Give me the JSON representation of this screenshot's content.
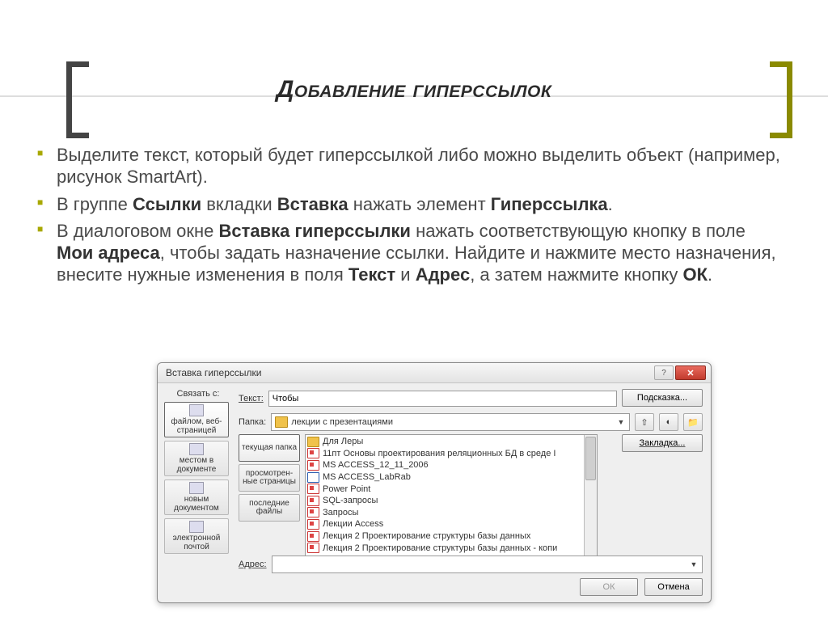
{
  "slide": {
    "title": "Добавление гиперссылок",
    "bullets": [
      {
        "pre": "Выделите текст, который будет гиперссылкой либо можно выделить объект (например, рисунок SmartArt)."
      },
      {
        "pre": "В группе ",
        "b1": "Ссылки",
        "mid1": " вкладки ",
        "b2": "Вставка",
        "mid2": " нажать элемент ",
        "b3": "Гиперссылка",
        "post": "."
      },
      {
        "pre": "В диалоговом окне ",
        "b1": "Вставка гиперссылки",
        "mid1": " нажать соответствующую кнопку в поле ",
        "b2": "Мои адреса",
        "mid2": ", чтобы задать назначение ссылки. Найдите и нажмите место назначения, внесите нужные изменения в поля ",
        "b3": "Текст",
        "mid3": " и ",
        "b4": "Адрес",
        "mid4": ", а затем нажмите кнопку ",
        "b5": "ОК",
        "post": "."
      }
    ]
  },
  "dialog": {
    "title": "Вставка гиперссылки",
    "link_with_label": "Связать с:",
    "tiles": [
      {
        "label": "файлом, веб-страницей",
        "active": true
      },
      {
        "label": "местом в документе",
        "active": false
      },
      {
        "label": "новым документом",
        "active": false
      },
      {
        "label": "электронной почтой",
        "active": false
      }
    ],
    "text_label": "Текст:",
    "text_value": "Чтобы",
    "hint_button": "Подсказка...",
    "folder_label": "Папка:",
    "folder_value": "лекции с презентациями",
    "browse_tabs": [
      {
        "label": "текущая папка",
        "active": true
      },
      {
        "label": "просмотрен-ные страницы",
        "active": false
      },
      {
        "label": "последние файлы",
        "active": false
      }
    ],
    "files": [
      {
        "type": "folder",
        "name": "Для Леры"
      },
      {
        "type": "ppt",
        "name": "11пт Основы проектирования реляционных БД в среде I"
      },
      {
        "type": "ppt",
        "name": "MS ACCESS_12_11_2006"
      },
      {
        "type": "doc",
        "name": "MS ACCESS_LabRab"
      },
      {
        "type": "ppt",
        "name": "Power Point"
      },
      {
        "type": "ppt",
        "name": "SQL-запросы"
      },
      {
        "type": "ppt",
        "name": "Запросы"
      },
      {
        "type": "ppt",
        "name": "Лекции Access"
      },
      {
        "type": "ppt",
        "name": "Лекция 2 Проектирование структуры базы данных"
      },
      {
        "type": "ppt",
        "name": "Лекция 2 Проектирование структуры базы данных - копи"
      }
    ],
    "bookmark_button": "Закладка...",
    "address_label": "Адрес:",
    "address_value": "",
    "ok_button": "ОК",
    "cancel_button": "Отмена"
  }
}
